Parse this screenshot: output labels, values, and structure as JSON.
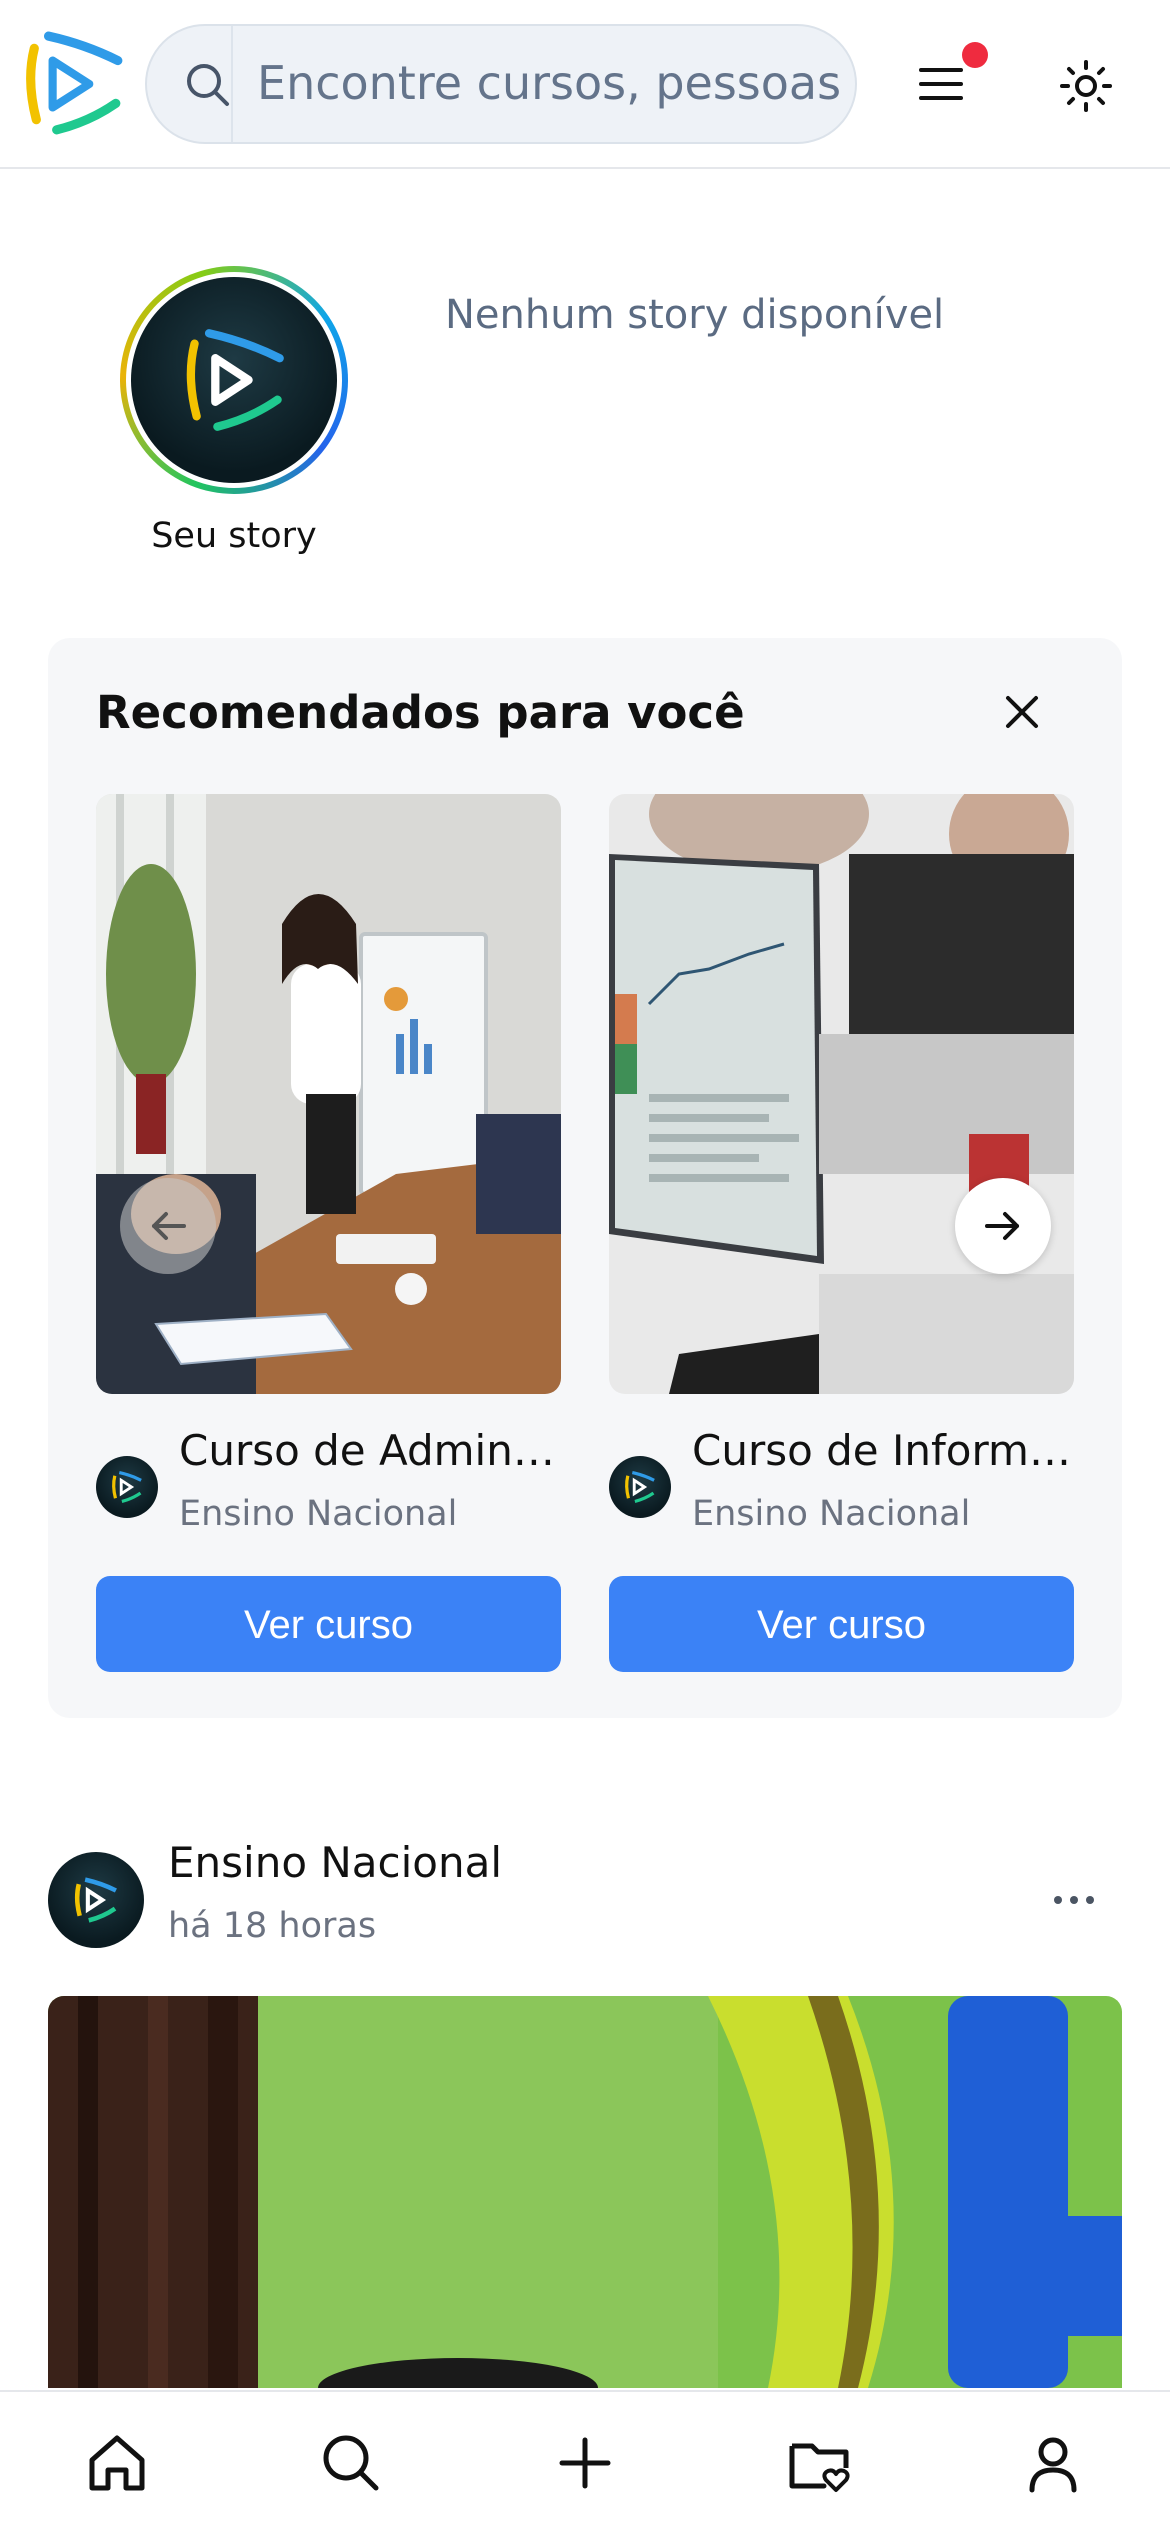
{
  "header": {
    "search_placeholder": "Encontre cursos, pessoas",
    "notification_dot_color": "#ef2b3f",
    "icons": [
      "app-logo",
      "search-icon",
      "menu-icon",
      "sun-icon"
    ]
  },
  "stories": {
    "own_label": "Seu story",
    "empty_message": "Nenhum story disponível"
  },
  "recommended": {
    "title": "Recomendados para você",
    "cards": [
      {
        "title": "Curso de Administração",
        "provider": "Ensino Nacional",
        "button": "Ver curso"
      },
      {
        "title": "Curso de Informática",
        "provider": "Ensino Nacional",
        "button": "Ver curso"
      }
    ]
  },
  "post": {
    "author": "Ensino Nacional",
    "time": "há 18 horas"
  },
  "bottom_nav": {
    "items": [
      "home-icon",
      "search-icon",
      "plus-icon",
      "folder-heart-icon",
      "user-icon"
    ]
  },
  "colors": {
    "accent": "#3b82f6",
    "brand_blue": "#2f9be8",
    "brand_yellow": "#f2c200",
    "brand_green": "#1fc98f"
  }
}
